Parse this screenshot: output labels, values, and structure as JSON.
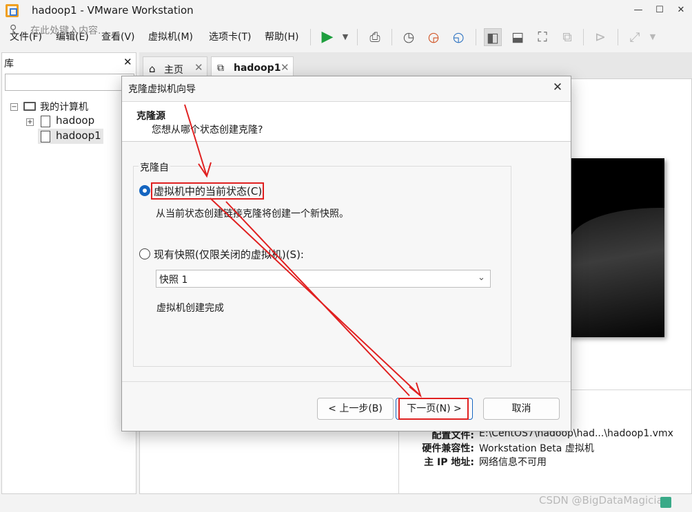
{
  "window": {
    "title": "hadoop1 - VMware Workstation"
  },
  "menu": {
    "items": [
      "文件(F)",
      "编辑(E)",
      "查看(V)",
      "虚拟机(M)",
      "选项卡(T)",
      "帮助(H)"
    ]
  },
  "library": {
    "header": "库",
    "search_placeholder": "在此处键入内容...",
    "tree": {
      "root": "我的计算机",
      "items": [
        "hadoop",
        "hadoop1"
      ]
    }
  },
  "tabs": [
    {
      "label": "主页"
    },
    {
      "label": "hadoop1"
    }
  ],
  "details": [
    {
      "label": "配置文件:",
      "value": "E:\\CentOS7\\hadoop\\had...\\hadoop1.vmx"
    },
    {
      "label": "硬件兼容性:",
      "value": "Workstation Beta 虚拟机"
    },
    {
      "label": "主 IP 地址:",
      "value": "网络信息不可用"
    }
  ],
  "watermark": "CSDN @BigDataMagician",
  "dialog": {
    "title": "克隆虚拟机向导",
    "heading": "克隆源",
    "subheading": "您想从哪个状态创建克隆?",
    "group_label": "克隆自",
    "option_current": {
      "label": "虚拟机中的当前状态(C)",
      "desc": "从当前状态创建链接克隆将创建一个新快照。",
      "selected": true
    },
    "option_snapshot": {
      "label": "现有快照(仅限关闭的虚拟机)(S):",
      "select_value": "快照 1",
      "desc": "虚拟机创建完成",
      "selected": false
    },
    "buttons": {
      "back": "< 上一步(B)",
      "next": "下一页(N) >",
      "cancel": "取消"
    }
  },
  "colors": {
    "accent": "#1565c0",
    "annotation": "#e02020",
    "run": "#1e9e3e"
  },
  "icons": [
    "vmware-logo-icon",
    "play-icon",
    "snapshot-icon",
    "revert-icon",
    "manage-snapshots-icon",
    "library-view-icon",
    "console-view-icon",
    "fullscreen-icon",
    "unity-icon",
    "terminal-icon",
    "stretch-icon"
  ]
}
